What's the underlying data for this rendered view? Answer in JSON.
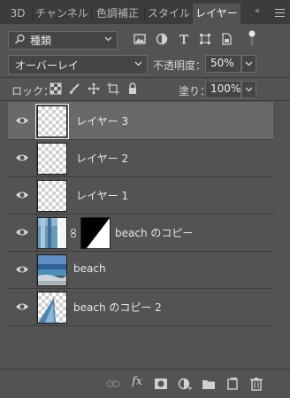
{
  "tabs": [
    {
      "label": "3D",
      "active": false
    },
    {
      "label": "チャンネル",
      "active": false
    },
    {
      "label": "色調補正",
      "active": false
    },
    {
      "label": "スタイル",
      "active": false
    },
    {
      "label": "レイヤー",
      "active": true
    }
  ],
  "collapse_label": "«",
  "filter": {
    "selected": "種類"
  },
  "filter_icons": [
    "image-filter-icon",
    "adjustment-filter-icon",
    "text-filter-icon",
    "shape-filter-icon",
    "smart-object-filter-icon"
  ],
  "blend": {
    "mode": "オーバーレイ"
  },
  "opacity": {
    "label": "不透明度：",
    "value": "50%"
  },
  "lock": {
    "label": "ロック：",
    "icons": [
      "lock-transparent-pixels-icon",
      "lock-image-pixels-icon",
      "lock-position-icon",
      "lock-artboard-icon",
      "lock-all-icon"
    ]
  },
  "fill": {
    "label": "塗り：",
    "value": "100%"
  },
  "layers": [
    {
      "name": "レイヤー 3",
      "visible": true,
      "selected": true,
      "thumbnail": "transparent"
    },
    {
      "name": "レイヤー 2",
      "visible": true,
      "selected": false,
      "thumbnail": "transparent"
    },
    {
      "name": "レイヤー 1",
      "visible": true,
      "selected": false,
      "thumbnail": "transparent"
    },
    {
      "name": "beach のコピー",
      "visible": true,
      "selected": false,
      "thumbnail": "beach-partial",
      "has_mask": true
    },
    {
      "name": "beach",
      "visible": true,
      "selected": false,
      "thumbnail": "beach"
    },
    {
      "name": "beach のコピー 2",
      "visible": true,
      "selected": false,
      "thumbnail": "beach-partial-2"
    }
  ],
  "bottom_icons": [
    "link-layers-icon",
    "layer-style-fx-icon",
    "add-mask-icon",
    "adjustment-layer-icon",
    "new-group-icon",
    "new-layer-icon",
    "delete-layer-icon"
  ],
  "fx_label": "fx",
  "colors": {
    "panel": "#535353",
    "tabbar": "#3c3c3c",
    "selected_row": "#696969"
  }
}
